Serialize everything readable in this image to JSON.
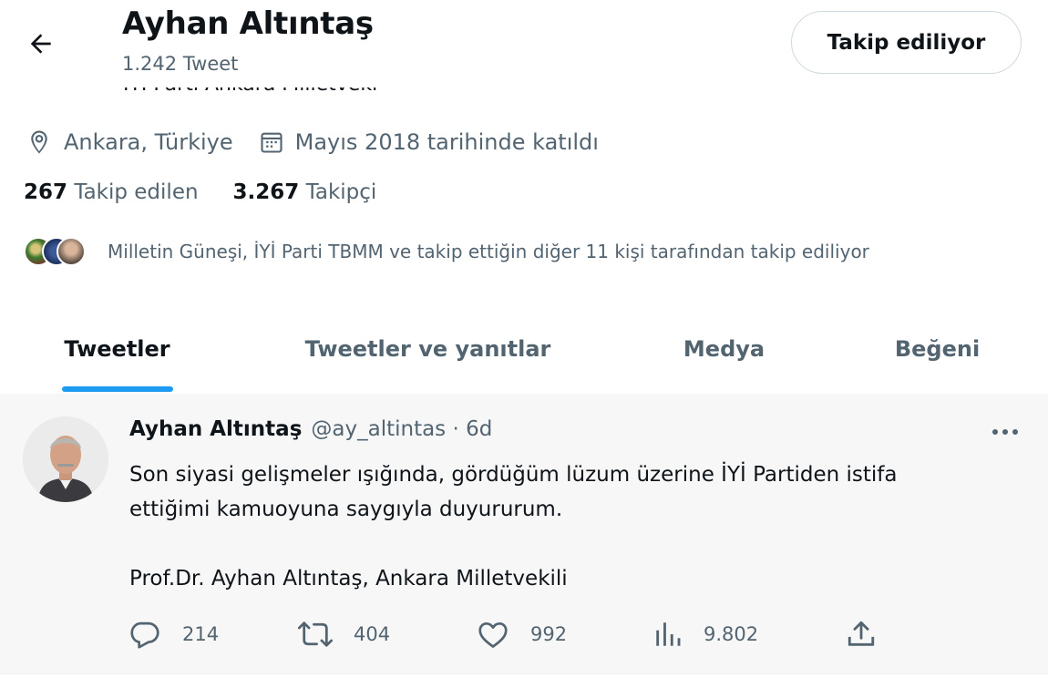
{
  "header": {
    "name": "Ayhan Altıntaş",
    "tweet_count": "1.242 Tweet",
    "follow_button": "Takip ediliyor"
  },
  "profile": {
    "bio_partial": "İYİ Parti Ankara Milletvekili",
    "location": "Ankara, Türkiye",
    "joined": "Mayıs 2018 tarihinde katıldı",
    "following_count": "267",
    "following_label": "Takip edilen",
    "followers_count": "3.267",
    "followers_label": "Takipçi",
    "followed_by": "Milletin Güneşi, İYİ Parti TBMM ve takip ettiğin diğer 11 kişi tarafından takip ediliyor"
  },
  "tabs": [
    {
      "label": "Tweetler",
      "active": true
    },
    {
      "label": "Tweetler ve yanıtlar",
      "active": false
    },
    {
      "label": "Medya",
      "active": false
    },
    {
      "label": "Beğeni",
      "active": false
    }
  ],
  "tweet": {
    "name": "Ayhan Altıntaş",
    "handle_time": "@ay_altintas · 6d",
    "text": "Son siyasi gelişmeler ışığında, gördüğüm lüzum üzerine İYİ Partiden istifa\nettiğimi kamuoyuna saygıyla duyururum.\n\nProf.Dr. Ayhan Altıntaş,  Ankara Milletvekili",
    "replies": "214",
    "retweets": "404",
    "likes": "992",
    "views": "9.802"
  },
  "colors": {
    "accent": "#1d9bf0",
    "secondary_text": "#536471",
    "primary_text": "#0f1419",
    "tweet_background": "#f7f7f7"
  },
  "icons": [
    "back-arrow-icon",
    "location-pin-icon",
    "calendar-icon",
    "more-icon",
    "reply-icon",
    "retweet-icon",
    "like-icon",
    "views-icon",
    "share-icon"
  ]
}
